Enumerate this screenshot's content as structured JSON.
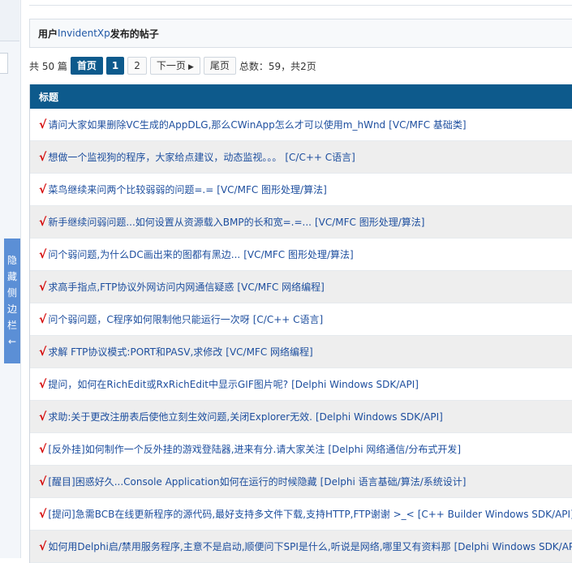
{
  "sidebar": {
    "toggle_label": "隐藏侧边栏",
    "chars": [
      "隐",
      "藏",
      "侧",
      "边",
      "栏",
      "←"
    ]
  },
  "header": {
    "prefix": "用户 ",
    "username": "InvidentXp",
    "suffix": "发布的帖子"
  },
  "pager": {
    "total_text": "共 50 篇",
    "first_label": "首页",
    "pages": [
      "1",
      "2"
    ],
    "next_label": "下一页",
    "next_icon": "▶",
    "last_label": "尾页",
    "summary": "总数：59，共2页"
  },
  "table": {
    "header": "标题",
    "check_icon": "√",
    "rows": [
      {
        "title": "请问大家如果删除VC生成的AppDLG,那么CWinApp怎么才可以使用m_hWnd",
        "category": "[VC/MFC 基础类]"
      },
      {
        "title": "想做一个监视狗的程序，大家给点建议，动态监视。。。",
        "category": "[C/C++ C语言]"
      },
      {
        "title": "菜鸟继续来问两个比较弱弱的问题=.=",
        "category": "[VC/MFC 图形处理/算法]"
      },
      {
        "title": "新手继续问弱问题...如何设置从资源载入BMP的长和宽=.=...",
        "category": "[VC/MFC 图形处理/算法]"
      },
      {
        "title": "问个弱问题,为什么DC画出来的图都有黑边...",
        "category": "[VC/MFC 图形处理/算法]"
      },
      {
        "title": "求高手指点,FTP协议外网访问内网通信疑惑",
        "category": "[VC/MFC 网络编程]"
      },
      {
        "title": "问个弱问题，C程序如何限制他只能运行一次呀",
        "category": "[C/C++ C语言]"
      },
      {
        "title": "求解 FTP协议模式:PORT和PASV,求修改",
        "category": "[VC/MFC 网络编程]"
      },
      {
        "title": "提问，如何在RichEdit或RxRichEdit中显示GIF图片呢?",
        "category": "[Delphi Windows SDK/API]"
      },
      {
        "title": "求助:关于更改注册表后使他立刻生效问题,关闭Explorer无效.",
        "category": "[Delphi Windows SDK/API]"
      },
      {
        "title": "[反外挂]如何制作一个反外挂的游戏登陆器,进来有分.请大家关注",
        "category": "[Delphi 网络通信/分布式开发]"
      },
      {
        "title": "[醒目]困惑好久...Console Application如何在运行的时候隐藏",
        "category": "[Delphi 语言基础/算法/系统设计]"
      },
      {
        "title": "[提问]急需BCB在线更新程序的源代码,最好支持多文件下载,支持HTTP,FTP谢谢 >_<",
        "category": "[C++ Builder Windows SDK/API]"
      },
      {
        "title": "如何用Delphi启/禁用服务程序,主意不是启动,顺便问下SPI是什么,听说是网络,哪里又有资料那",
        "category": "[Delphi Windows SDK/API]"
      }
    ]
  }
}
